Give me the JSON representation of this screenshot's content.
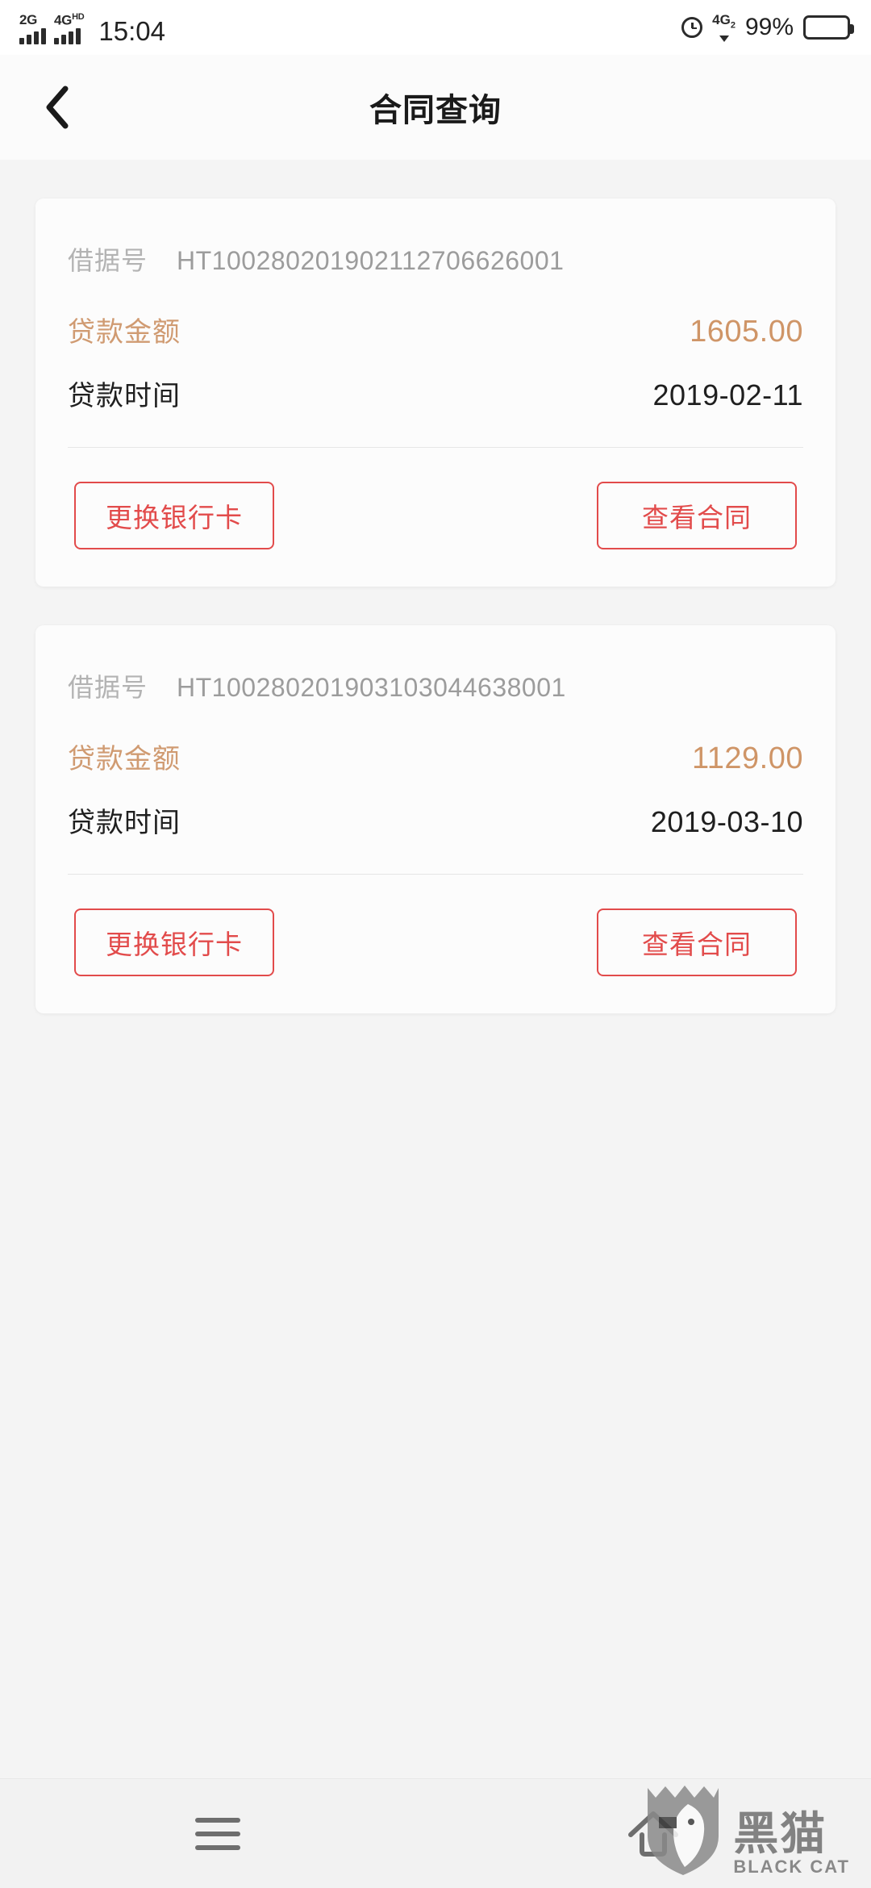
{
  "statusbar": {
    "sim1_label": "2G",
    "sim2_label": "4G",
    "sim2_sup": "HD",
    "time": "15:04",
    "alarm_icon": "alarm-clock-icon",
    "network_label": "4G",
    "network_sub": "2",
    "battery_percent": "99%"
  },
  "header": {
    "back_icon": "chevron-left-icon",
    "title": "合同查询"
  },
  "labels": {
    "loan_no": "借据号",
    "loan_amount": "贷款金额",
    "loan_date": "贷款时间",
    "btn_change_card": "更换银行卡",
    "btn_view_contract": "查看合同"
  },
  "colors": {
    "accent_orange": "#cf9567",
    "accent_red": "#e24b4b",
    "muted_grey": "#9c9c9c",
    "label_grey": "#b3b3b3",
    "text_dark": "#1f1f1f"
  },
  "cards": [
    {
      "loan_no": "HT100280201902112706626001",
      "amount": "1605.00",
      "date": "2019-02-11"
    },
    {
      "loan_no": "HT100280201903103044638001",
      "amount": "1129.00",
      "date": "2019-03-10"
    }
  ],
  "navbar": {
    "menu_icon": "hamburger-menu-icon",
    "home_icon": "home-icon"
  },
  "watermark": {
    "cn": "黑猫",
    "en": "BLACK CAT"
  }
}
